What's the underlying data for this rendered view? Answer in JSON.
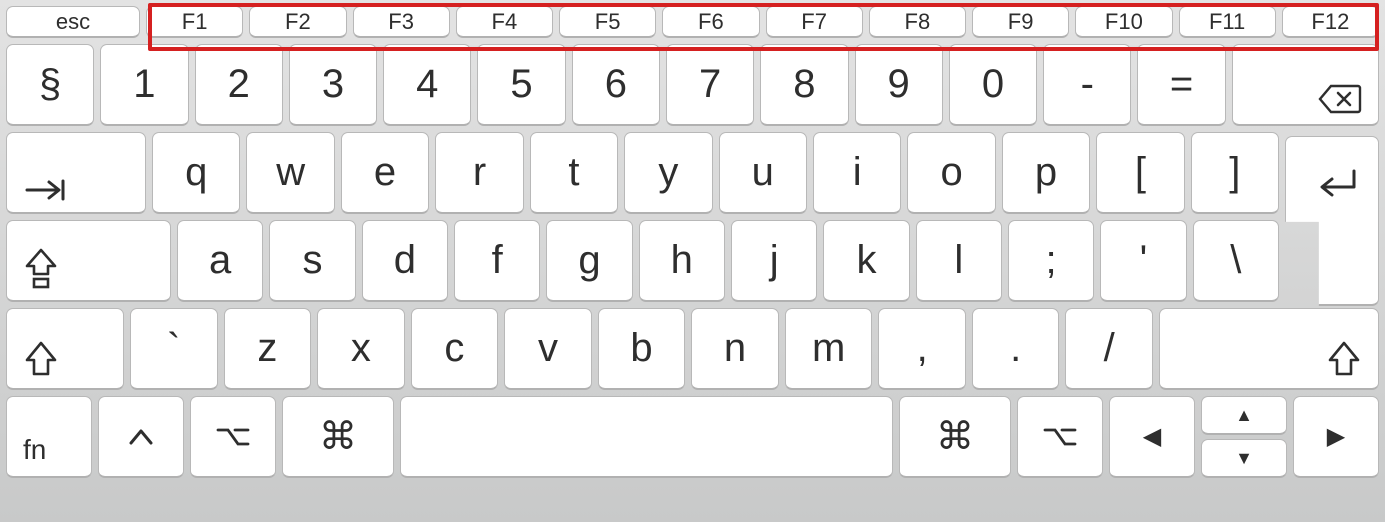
{
  "highlight": {
    "target": "function-keys-row",
    "color": "#d52020"
  },
  "function_row": {
    "esc": "esc",
    "keys": [
      "F1",
      "F2",
      "F3",
      "F4",
      "F5",
      "F6",
      "F7",
      "F8",
      "F9",
      "F10",
      "F11",
      "F12"
    ]
  },
  "rows": {
    "number": {
      "leading": "§",
      "keys": [
        "1",
        "2",
        "3",
        "4",
        "5",
        "6",
        "7",
        "8",
        "9",
        "0",
        "-",
        "="
      ],
      "backspace_icon": "backspace"
    },
    "qwerty": {
      "tab_icon": "tab",
      "keys": [
        "q",
        "w",
        "e",
        "r",
        "t",
        "y",
        "u",
        "i",
        "o",
        "p",
        "[",
        "]"
      ],
      "enter_icon": "return"
    },
    "home": {
      "capslock_icon": "capslock",
      "keys": [
        "a",
        "s",
        "d",
        "f",
        "g",
        "h",
        "j",
        "k",
        "l",
        ";",
        "'",
        "\\"
      ]
    },
    "shift": {
      "left_shift_icon": "shift",
      "after_shift_key": "`",
      "keys": [
        "z",
        "x",
        "c",
        "v",
        "b",
        "n",
        "m",
        ",",
        ".",
        "/"
      ],
      "right_shift_icon": "shift"
    },
    "bottom": {
      "fn": "fn",
      "control_icon": "control",
      "option_icon": "option",
      "command_icon": "command",
      "space": "",
      "arrows": {
        "left": "◀",
        "up": "▲",
        "down": "▼",
        "right": "▶"
      }
    }
  }
}
